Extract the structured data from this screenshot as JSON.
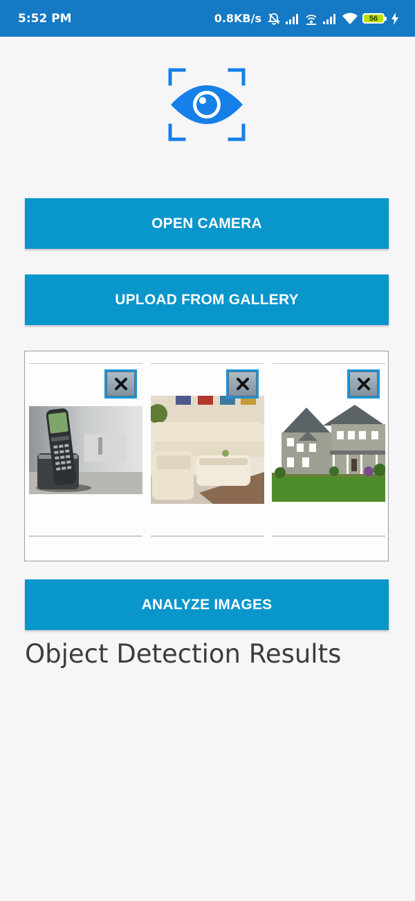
{
  "status_bar": {
    "time": "5:52 PM",
    "net_speed": "0.8KB/s",
    "battery_level": "56",
    "icons": [
      "mute-bell-icon",
      "signal-icon",
      "wifi-hotspot-icon",
      "signal-icon",
      "wifi-icon",
      "battery-icon",
      "charging-bolt-icon"
    ]
  },
  "logo": {
    "icon": "eye-scan-icon",
    "color": "#1580e8"
  },
  "buttons": {
    "open_camera": "OPEN CAMERA",
    "upload_gallery": "UPLOAD FROM GALLERY",
    "analyze": "ANALYZE IMAGES"
  },
  "gallery": {
    "images": [
      {
        "subject": "cordless-phone-image",
        "remove_icon": "close-icon"
      },
      {
        "subject": "living-room-sofa-image",
        "remove_icon": "close-icon"
      },
      {
        "subject": "house-exterior-image",
        "remove_icon": "close-icon"
      }
    ]
  },
  "results": {
    "title": "Object Detection Results"
  },
  "colors": {
    "status_bar": "#1579c4",
    "button": "#0896cb",
    "remove_button": "#1c95dc"
  }
}
